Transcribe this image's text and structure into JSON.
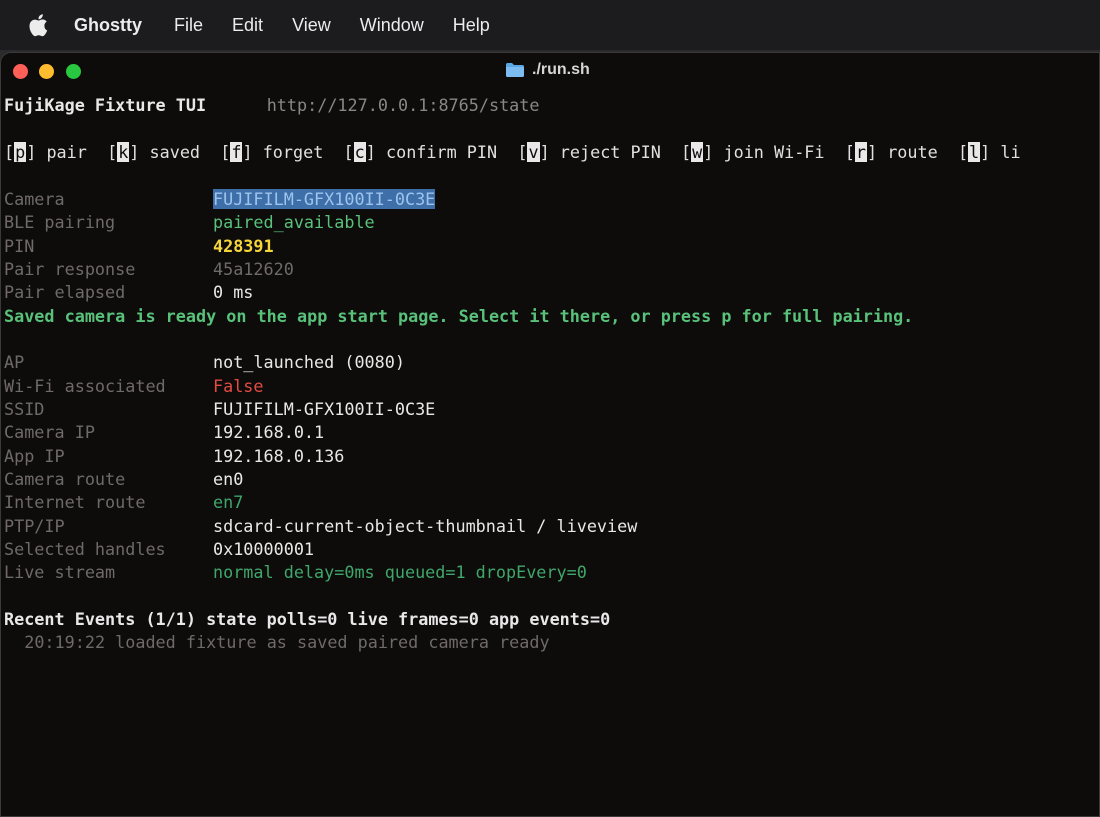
{
  "menubar": {
    "app_name": "Ghostty",
    "items": [
      "File",
      "Edit",
      "View",
      "Window",
      "Help"
    ]
  },
  "window": {
    "title": "./run.sh"
  },
  "tui": {
    "app_title": "FujiKage Fixture TUI",
    "url": "http://127.0.0.1:8765/state",
    "commands": [
      {
        "key": "p",
        "label": "pair"
      },
      {
        "key": "k",
        "label": "saved"
      },
      {
        "key": "f",
        "label": "forget"
      },
      {
        "key": "c",
        "label": "confirm PIN"
      },
      {
        "key": "v",
        "label": "reject PIN"
      },
      {
        "key": "w",
        "label": "join Wi-Fi"
      },
      {
        "key": "r",
        "label": "route"
      },
      {
        "key": "l",
        "label": "li"
      }
    ],
    "camera": {
      "camera_label": "Camera",
      "camera_value": "FUJIFILM-GFX100II-0C3E",
      "ble_label": "BLE pairing",
      "ble_value": "paired_available",
      "pin_label": "PIN",
      "pin_value": "428391",
      "pair_response_label": "Pair response",
      "pair_response_value": "45a12620",
      "pair_elapsed_label": "Pair elapsed",
      "pair_elapsed_value": "0 ms",
      "status_message": "Saved camera is ready on the app start page. Select it there, or press p for full pairing."
    },
    "network": {
      "ap_label": "AP",
      "ap_value": "not_launched (0080)",
      "wifi_label": "Wi-Fi associated",
      "wifi_value": "False",
      "ssid_label": "SSID",
      "ssid_value": "FUJIFILM-GFX100II-0C3E",
      "camera_ip_label": "Camera IP",
      "camera_ip_value": "192.168.0.1",
      "app_ip_label": "App IP",
      "app_ip_value": "192.168.0.136",
      "camera_route_label": "Camera route",
      "camera_route_value": "en0",
      "internet_route_label": "Internet route",
      "internet_route_value": "en7",
      "ptpip_label": "PTP/IP",
      "ptpip_value": "sdcard-current-object-thumbnail / liveview",
      "handles_label": "Selected handles",
      "handles_value": "0x10000001",
      "live_label": "Live stream",
      "live_value": "normal delay=0ms queued=1 dropEvery=0"
    },
    "events": {
      "header": "Recent Events (1/1) state polls=0 live frames=0 app events=0",
      "items": [
        "20:19:22 loaded fixture as saved paired camera ready"
      ]
    }
  },
  "colors": {
    "terminal_bg": "#0e0b0b",
    "green": "#59c27a",
    "red": "#e34b42",
    "yellow": "#f4d63c",
    "selection": "#3e6fa8"
  }
}
